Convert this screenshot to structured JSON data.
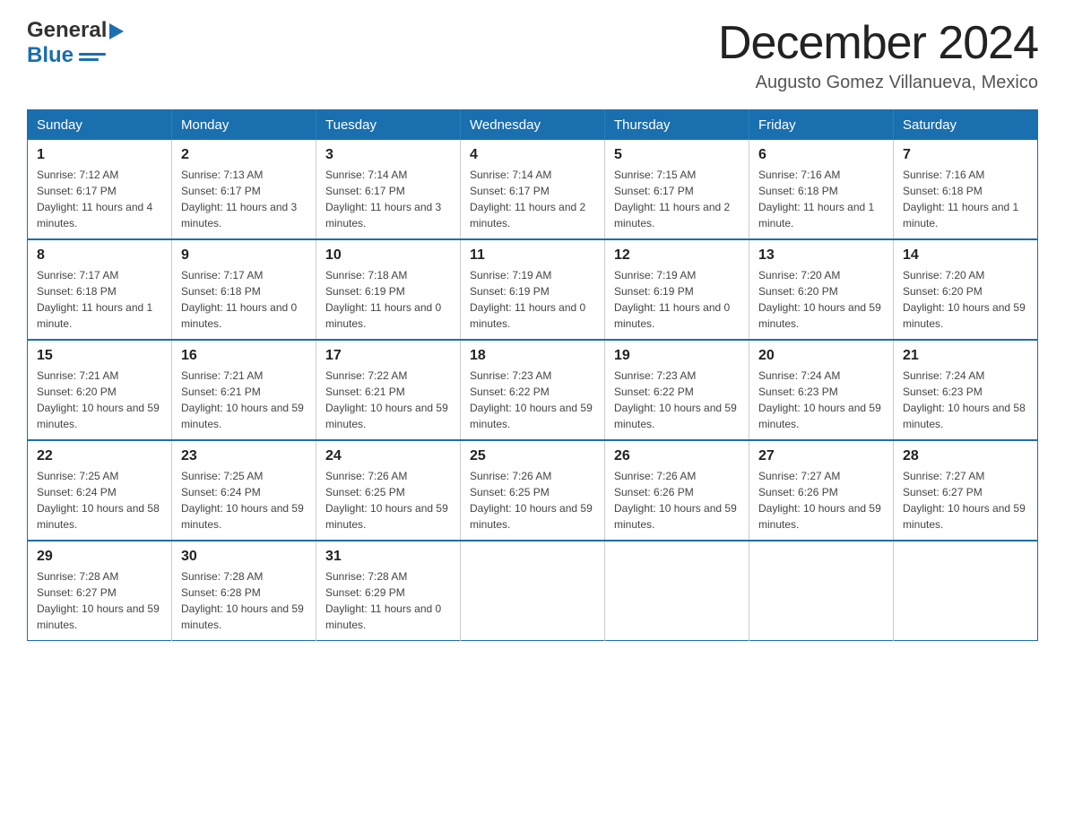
{
  "header": {
    "logo_general": "General",
    "logo_blue": "Blue",
    "month_title": "December 2024",
    "location": "Augusto Gomez Villanueva, Mexico"
  },
  "weekdays": [
    "Sunday",
    "Monday",
    "Tuesday",
    "Wednesday",
    "Thursday",
    "Friday",
    "Saturday"
  ],
  "weeks": [
    [
      {
        "day": "1",
        "sunrise": "Sunrise: 7:12 AM",
        "sunset": "Sunset: 6:17 PM",
        "daylight": "Daylight: 11 hours and 4 minutes."
      },
      {
        "day": "2",
        "sunrise": "Sunrise: 7:13 AM",
        "sunset": "Sunset: 6:17 PM",
        "daylight": "Daylight: 11 hours and 3 minutes."
      },
      {
        "day": "3",
        "sunrise": "Sunrise: 7:14 AM",
        "sunset": "Sunset: 6:17 PM",
        "daylight": "Daylight: 11 hours and 3 minutes."
      },
      {
        "day": "4",
        "sunrise": "Sunrise: 7:14 AM",
        "sunset": "Sunset: 6:17 PM",
        "daylight": "Daylight: 11 hours and 2 minutes."
      },
      {
        "day": "5",
        "sunrise": "Sunrise: 7:15 AM",
        "sunset": "Sunset: 6:17 PM",
        "daylight": "Daylight: 11 hours and 2 minutes."
      },
      {
        "day": "6",
        "sunrise": "Sunrise: 7:16 AM",
        "sunset": "Sunset: 6:18 PM",
        "daylight": "Daylight: 11 hours and 1 minute."
      },
      {
        "day": "7",
        "sunrise": "Sunrise: 7:16 AM",
        "sunset": "Sunset: 6:18 PM",
        "daylight": "Daylight: 11 hours and 1 minute."
      }
    ],
    [
      {
        "day": "8",
        "sunrise": "Sunrise: 7:17 AM",
        "sunset": "Sunset: 6:18 PM",
        "daylight": "Daylight: 11 hours and 1 minute."
      },
      {
        "day": "9",
        "sunrise": "Sunrise: 7:17 AM",
        "sunset": "Sunset: 6:18 PM",
        "daylight": "Daylight: 11 hours and 0 minutes."
      },
      {
        "day": "10",
        "sunrise": "Sunrise: 7:18 AM",
        "sunset": "Sunset: 6:19 PM",
        "daylight": "Daylight: 11 hours and 0 minutes."
      },
      {
        "day": "11",
        "sunrise": "Sunrise: 7:19 AM",
        "sunset": "Sunset: 6:19 PM",
        "daylight": "Daylight: 11 hours and 0 minutes."
      },
      {
        "day": "12",
        "sunrise": "Sunrise: 7:19 AM",
        "sunset": "Sunset: 6:19 PM",
        "daylight": "Daylight: 11 hours and 0 minutes."
      },
      {
        "day": "13",
        "sunrise": "Sunrise: 7:20 AM",
        "sunset": "Sunset: 6:20 PM",
        "daylight": "Daylight: 10 hours and 59 minutes."
      },
      {
        "day": "14",
        "sunrise": "Sunrise: 7:20 AM",
        "sunset": "Sunset: 6:20 PM",
        "daylight": "Daylight: 10 hours and 59 minutes."
      }
    ],
    [
      {
        "day": "15",
        "sunrise": "Sunrise: 7:21 AM",
        "sunset": "Sunset: 6:20 PM",
        "daylight": "Daylight: 10 hours and 59 minutes."
      },
      {
        "day": "16",
        "sunrise": "Sunrise: 7:21 AM",
        "sunset": "Sunset: 6:21 PM",
        "daylight": "Daylight: 10 hours and 59 minutes."
      },
      {
        "day": "17",
        "sunrise": "Sunrise: 7:22 AM",
        "sunset": "Sunset: 6:21 PM",
        "daylight": "Daylight: 10 hours and 59 minutes."
      },
      {
        "day": "18",
        "sunrise": "Sunrise: 7:23 AM",
        "sunset": "Sunset: 6:22 PM",
        "daylight": "Daylight: 10 hours and 59 minutes."
      },
      {
        "day": "19",
        "sunrise": "Sunrise: 7:23 AM",
        "sunset": "Sunset: 6:22 PM",
        "daylight": "Daylight: 10 hours and 59 minutes."
      },
      {
        "day": "20",
        "sunrise": "Sunrise: 7:24 AM",
        "sunset": "Sunset: 6:23 PM",
        "daylight": "Daylight: 10 hours and 59 minutes."
      },
      {
        "day": "21",
        "sunrise": "Sunrise: 7:24 AM",
        "sunset": "Sunset: 6:23 PM",
        "daylight": "Daylight: 10 hours and 58 minutes."
      }
    ],
    [
      {
        "day": "22",
        "sunrise": "Sunrise: 7:25 AM",
        "sunset": "Sunset: 6:24 PM",
        "daylight": "Daylight: 10 hours and 58 minutes."
      },
      {
        "day": "23",
        "sunrise": "Sunrise: 7:25 AM",
        "sunset": "Sunset: 6:24 PM",
        "daylight": "Daylight: 10 hours and 59 minutes."
      },
      {
        "day": "24",
        "sunrise": "Sunrise: 7:26 AM",
        "sunset": "Sunset: 6:25 PM",
        "daylight": "Daylight: 10 hours and 59 minutes."
      },
      {
        "day": "25",
        "sunrise": "Sunrise: 7:26 AM",
        "sunset": "Sunset: 6:25 PM",
        "daylight": "Daylight: 10 hours and 59 minutes."
      },
      {
        "day": "26",
        "sunrise": "Sunrise: 7:26 AM",
        "sunset": "Sunset: 6:26 PM",
        "daylight": "Daylight: 10 hours and 59 minutes."
      },
      {
        "day": "27",
        "sunrise": "Sunrise: 7:27 AM",
        "sunset": "Sunset: 6:26 PM",
        "daylight": "Daylight: 10 hours and 59 minutes."
      },
      {
        "day": "28",
        "sunrise": "Sunrise: 7:27 AM",
        "sunset": "Sunset: 6:27 PM",
        "daylight": "Daylight: 10 hours and 59 minutes."
      }
    ],
    [
      {
        "day": "29",
        "sunrise": "Sunrise: 7:28 AM",
        "sunset": "Sunset: 6:27 PM",
        "daylight": "Daylight: 10 hours and 59 minutes."
      },
      {
        "day": "30",
        "sunrise": "Sunrise: 7:28 AM",
        "sunset": "Sunset: 6:28 PM",
        "daylight": "Daylight: 10 hours and 59 minutes."
      },
      {
        "day": "31",
        "sunrise": "Sunrise: 7:28 AM",
        "sunset": "Sunset: 6:29 PM",
        "daylight": "Daylight: 11 hours and 0 minutes."
      },
      null,
      null,
      null,
      null
    ]
  ]
}
